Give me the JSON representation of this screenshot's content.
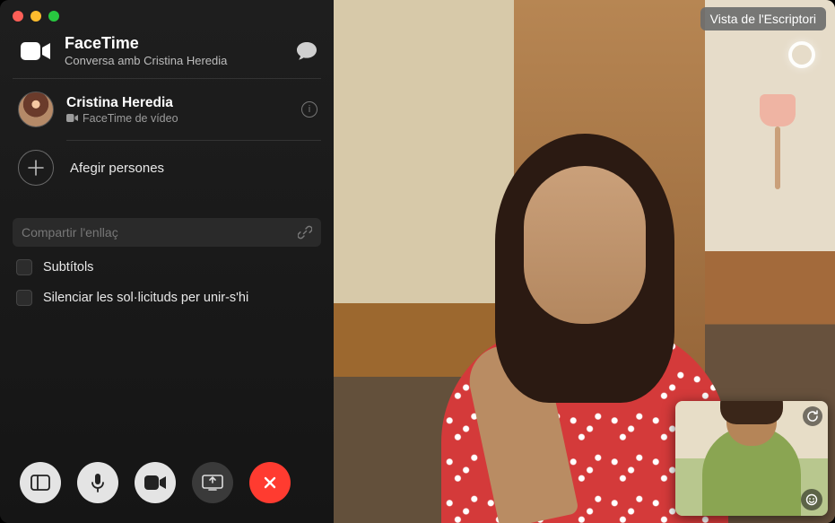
{
  "app": {
    "title": "FaceTime",
    "subtitle": "Conversa amb Cristina Heredia"
  },
  "participant": {
    "name": "Cristina Heredia",
    "subtitle": "FaceTime de vídeo"
  },
  "add_people_label": "Afegir persones",
  "share_link_placeholder": "Compartir l'enllaç",
  "options": {
    "subtitles": "Subtítols",
    "silence_join": "Silenciar les sol·licituds per unir-s'hi"
  },
  "desktop_badge": "Vista de l'Escriptori",
  "icons": {
    "chat": "chat-icon",
    "video": "video-icon",
    "info": "info-icon",
    "plus": "plus-icon",
    "link": "link-icon",
    "sidebar_ctrl": "sidebar-toggle-icon",
    "mic": "microphone-icon",
    "camera": "camera-icon",
    "screenshare": "screenshare-icon",
    "end": "end-call-icon",
    "live": "live-photo-icon",
    "rotate": "rotate-icon",
    "reactions": "reactions-icon"
  },
  "colors": {
    "end_call": "#ff3b30",
    "sidebar_bg": "#1a1a1a"
  }
}
